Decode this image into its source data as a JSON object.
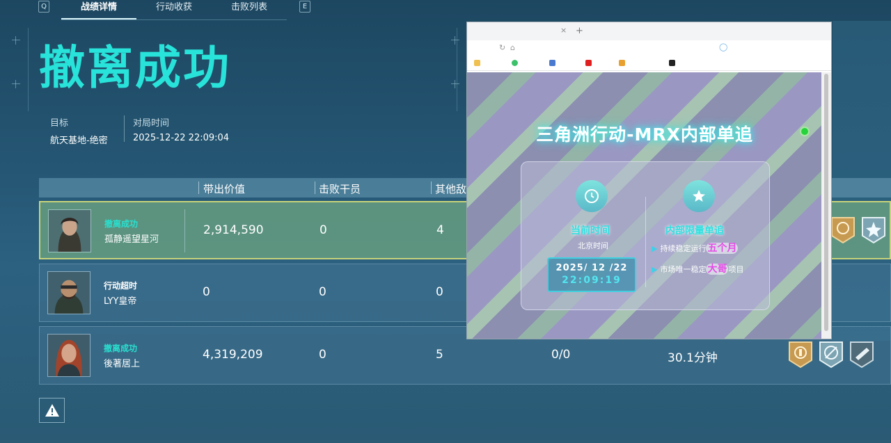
{
  "tab_bar": {
    "prev_key": "Q",
    "next_key": "E",
    "tabs": [
      {
        "label": "战绩详情",
        "active": true
      },
      {
        "label": "行动收获",
        "active": false
      },
      {
        "label": "击败列表",
        "active": false
      }
    ]
  },
  "result_title": "撤离成功",
  "meta": {
    "target_label": "目标",
    "target_value": "航天基地-绝密",
    "time_label": "对局时间",
    "time_value": "2025-12-22 22:09:04"
  },
  "table": {
    "headers": [
      "带出价值",
      "击败干员",
      "其他敌"
    ],
    "rows": [
      {
        "status": "撤离成功",
        "name": "孤静遥望星河",
        "value": "2,914,590",
        "kills": "0",
        "other": "4",
        "ratio": "",
        "duration": "",
        "highlight": true
      },
      {
        "status": "行动超时",
        "name": "LYY皇帝",
        "value": "0",
        "kills": "0",
        "other": "0",
        "ratio": "",
        "duration": "",
        "highlight": false
      },
      {
        "status": "撤离成功",
        "name": "後著居上",
        "value": "4,319,209",
        "kills": "0",
        "other": "5",
        "ratio": "0/0",
        "duration": "30.1分钟",
        "highlight": false
      }
    ]
  },
  "overlay": {
    "title": "三角洲行动-MRX内部单追",
    "left_head": "当前时间",
    "left_sub": "北京时间",
    "clock_date": "2025/ 12 /22",
    "clock_time": "22:09:19",
    "right_head": "内部限量单追",
    "item1_pre": "持续稳定运行",
    "item1_hl": "五个月",
    "item2_pre": "市场唯一稳定",
    "item2_hl": "大哥",
    "item2_post": "项目"
  },
  "colors": {
    "accent_cyan": "#28e3d9",
    "row_highlight": "#6ea582",
    "highlight_border": "#c9d37a"
  }
}
